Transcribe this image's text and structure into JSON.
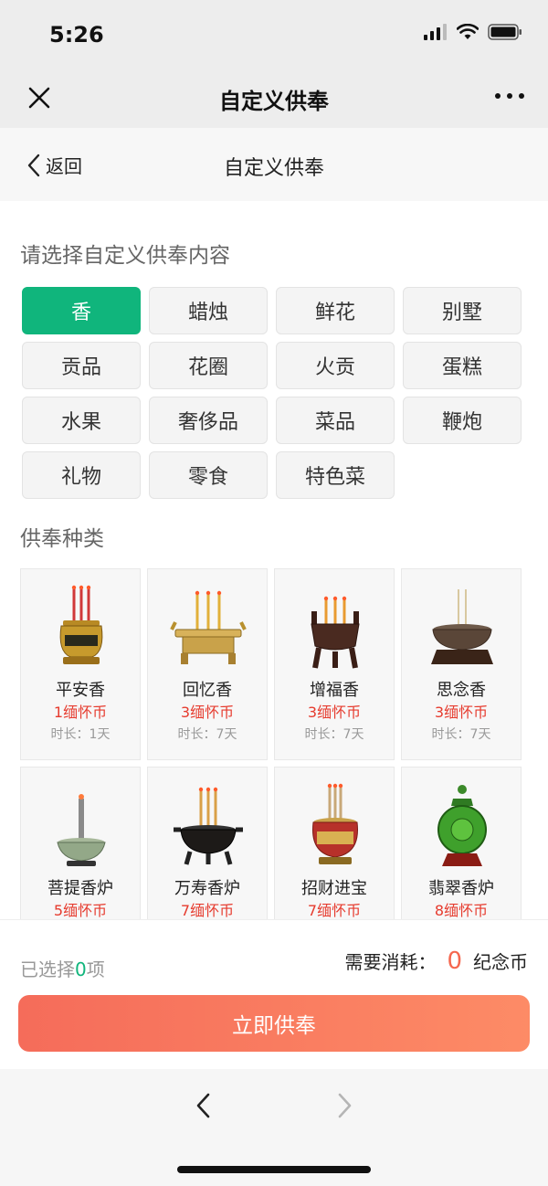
{
  "status": {
    "time": "5:26"
  },
  "wx_nav": {
    "title": "自定义供奉"
  },
  "header": {
    "back_label": "返回",
    "title": "自定义供奉"
  },
  "categories": {
    "heading": "请选择自定义供奉内容",
    "active_index": 0,
    "items": [
      "香",
      "蜡烛",
      "鲜花",
      "别墅",
      "贡品",
      "花圈",
      "火贡",
      "蛋糕",
      "水果",
      "奢侈品",
      "菜品",
      "鞭炮",
      "礼物",
      "零食",
      "特色菜"
    ]
  },
  "offerings": {
    "heading": "供奉种类",
    "items": [
      {
        "name": "平安香",
        "price": "1缅怀币",
        "duration": "时长：1天",
        "icon": "incense-burner-gold-icon"
      },
      {
        "name": "回忆香",
        "price": "3缅怀币",
        "duration": "时长：7天",
        "icon": "incense-altar-icon"
      },
      {
        "name": "增福香",
        "price": "3缅怀币",
        "duration": "时长：7天",
        "icon": "tripod-cauldron-icon"
      },
      {
        "name": "思念香",
        "price": "3缅怀币",
        "duration": "时长：7天",
        "icon": "bronze-censer-icon"
      },
      {
        "name": "菩提香炉",
        "price": "5缅怀币",
        "duration": "",
        "icon": "celadon-burner-icon"
      },
      {
        "name": "万寿香炉",
        "price": "7缅怀币",
        "duration": "",
        "icon": "black-censer-icon"
      },
      {
        "name": "招财进宝",
        "price": "7缅怀币",
        "duration": "",
        "icon": "fortune-burner-icon"
      },
      {
        "name": "翡翠香炉",
        "price": "8缅怀币",
        "duration": "",
        "icon": "jade-burner-icon"
      }
    ]
  },
  "summary": {
    "selected_prefix": "已选择",
    "selected_count": "0",
    "selected_suffix": "项",
    "cost_label": "需要消耗：",
    "cost_value": "0",
    "cost_unit": "纪念币",
    "submit_label": "立即供奉"
  },
  "colors": {
    "accent": "#10b57c",
    "price": "#e63b2e",
    "submit_start": "#f56c5a",
    "submit_end": "#fd8b66"
  }
}
